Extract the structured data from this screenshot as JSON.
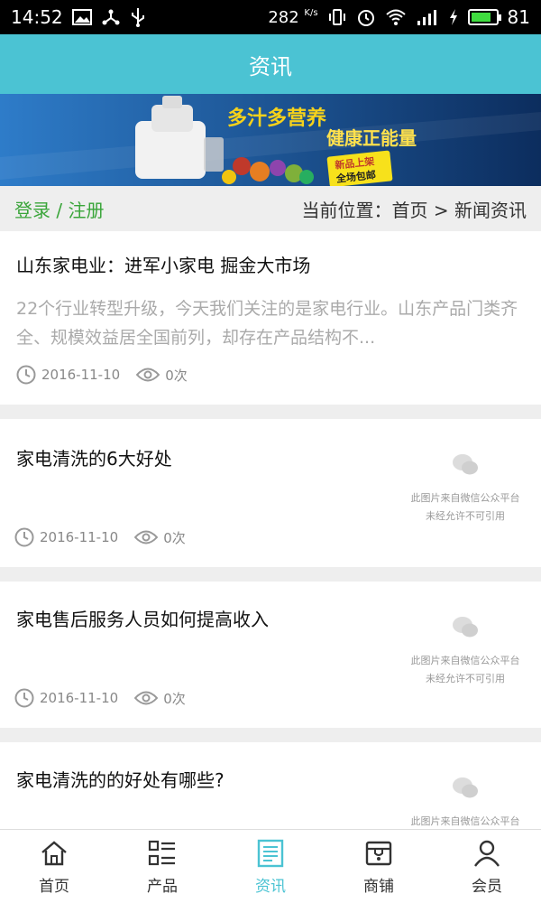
{
  "status_bar": {
    "time": "14:52",
    "net_speed": "282",
    "net_unit": "K/s",
    "battery": "81",
    "battery_color": "#3fdc3f"
  },
  "header": {
    "title": "资讯",
    "color": "#4bc3d3"
  },
  "banner": {
    "headline": "多汁多营养",
    "subline": "健康正能量",
    "badge_line1": "新品上架",
    "badge_line2": "全场包邮"
  },
  "location_bar": {
    "login": "登录",
    "separator": "/",
    "register": "注册",
    "breadcrumb": "当前位置：首页 > 新闻资讯"
  },
  "articles": [
    {
      "title": "山东家电业：进军小家电 掘金大市场",
      "summary": "22个行业转型升级，今天我们关注的是家电行业。山东产品门类齐全、规模效益居全国前列，却存在产品结构不...",
      "date": "2016-11-10",
      "views": "0次"
    },
    {
      "title": "家电清洗的6大好处",
      "date": "2016-11-10",
      "views": "0次",
      "thumb_line1": "此图片来自微信公众平台",
      "thumb_line2": "未经允许不可引用"
    },
    {
      "title": "家电售后服务人员如何提高收入",
      "date": "2016-11-10",
      "views": "0次",
      "thumb_line1": "此图片来自微信公众平台",
      "thumb_line2": "未经允许不可引用"
    },
    {
      "title": "家电清洗的的好处有哪些?",
      "thumb_line1": "此图片来自微信公众平台"
    }
  ],
  "tabs": [
    {
      "label": "首页",
      "icon": "home-icon"
    },
    {
      "label": "产品",
      "icon": "list-icon"
    },
    {
      "label": "资讯",
      "icon": "news-icon",
      "active": true
    },
    {
      "label": "商铺",
      "icon": "shop-icon"
    },
    {
      "label": "会员",
      "icon": "user-icon"
    }
  ]
}
